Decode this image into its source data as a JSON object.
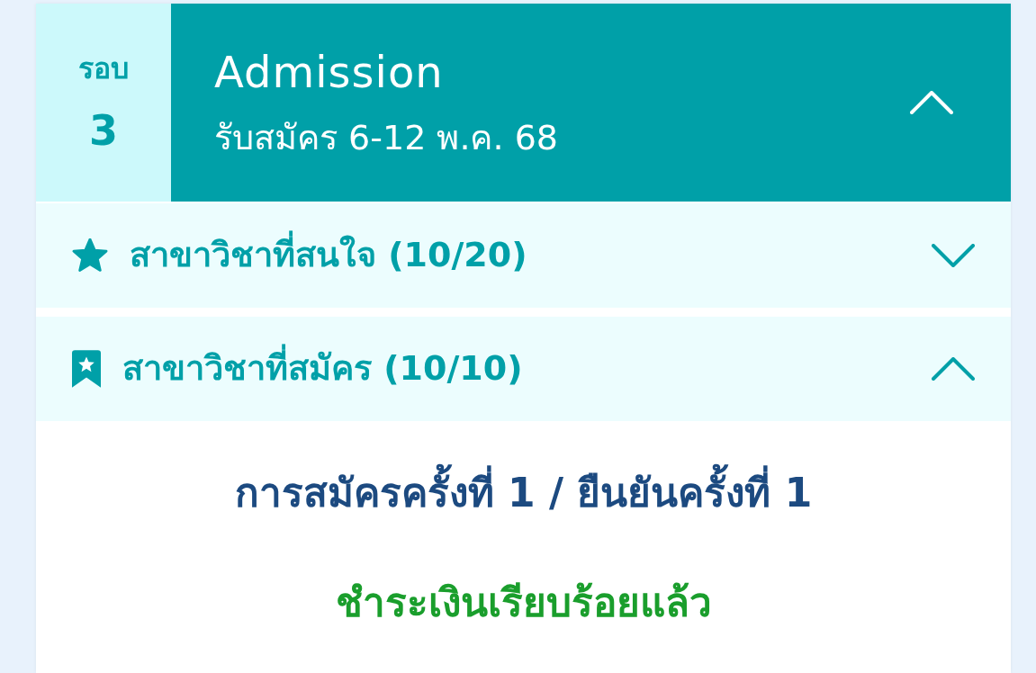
{
  "round": {
    "label": "รอบ",
    "number": "3"
  },
  "header": {
    "title": "Admission",
    "subtitle": "รับสมัคร 6-12 พ.ค. 68",
    "expanded": true
  },
  "sections": [
    {
      "kind": "interested",
      "label": "สาขาวิชาที่สนใจ (10/20)",
      "expanded": false
    },
    {
      "kind": "applied",
      "label": "สาขาวิชาที่สมัคร (10/10)",
      "expanded": true
    }
  ],
  "application": {
    "title": "การสมัครครั้งที่ 1 / ยืนยันครั้งที่ 1",
    "status": "ชำระเงินเรียบร้อยแล้ว"
  }
}
